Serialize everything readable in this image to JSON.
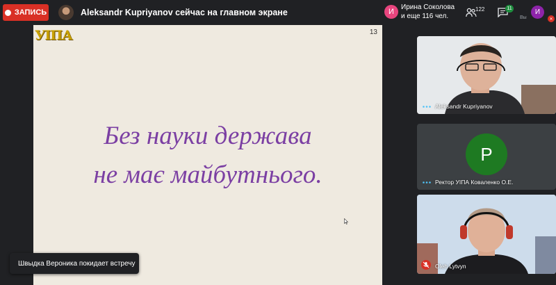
{
  "topbar": {
    "record_label": "ЗАПИСЬ",
    "presenter_text": "Aleksandr Kupriyanov сейчас на главном экране",
    "participant_initial": "И",
    "participant_name": "Ирина Соколова",
    "participant_more": "и еще 116 чел.",
    "people_count": "122",
    "chat_badge": "11",
    "self_initial": "И",
    "self_label": "Вы"
  },
  "slide": {
    "logo": "УІПА",
    "page_number": "13",
    "line1": "Без науки держава",
    "line2": "не має майбутнього."
  },
  "toast": "Швыдка Вероника покидает встречу",
  "tiles": [
    {
      "name": "Aleksandr Kupriyanov"
    },
    {
      "name": "Ректор УІПА Коваленко О.Е.",
      "initial": "Р"
    },
    {
      "name": "Oleh Lytvyn"
    }
  ],
  "colors": {
    "record": "#d93025",
    "slide_text": "#7b3fa3",
    "slide_bg": "#efeae0",
    "avatar_green": "#1e7a22"
  }
}
